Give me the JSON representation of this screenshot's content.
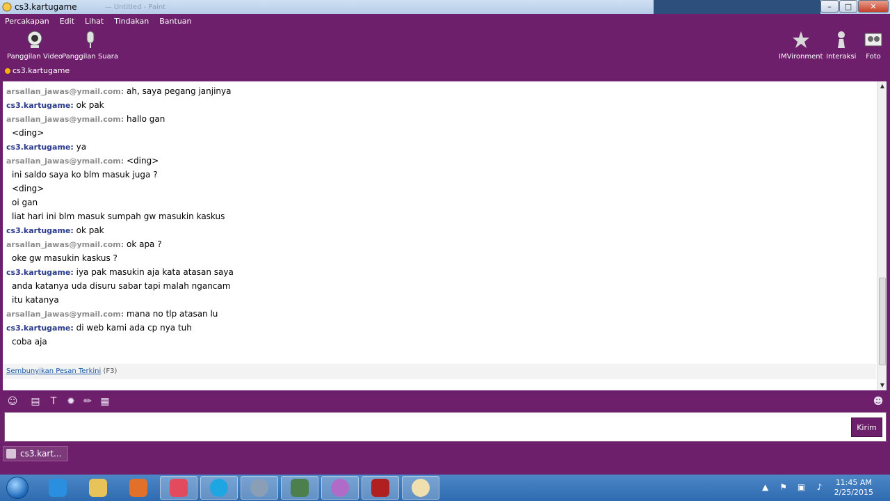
{
  "window": {
    "title": "cs3.kartugame",
    "ghost_title": "— Untitled - Paint"
  },
  "menu": [
    "Percakapan",
    "Edit",
    "Lihat",
    "Tindakan",
    "Bantuan"
  ],
  "toolbar": {
    "video_call": "Panggilan Video",
    "voice_call": "Panggilan Suara",
    "imvironment": "IMVironment",
    "interaksi": "Interaksi",
    "foto": "Foto"
  },
  "contact": {
    "name": "cs3.kartugame"
  },
  "chat": {
    "messages": [
      {
        "sender": "arsallan_jawas@ymail.com:",
        "kind": "a",
        "lines": [
          "ah, saya pegang janjinya"
        ]
      },
      {
        "sender": "cs3.kartugame:",
        "kind": "c",
        "lines": [
          "ok pak"
        ]
      },
      {
        "sender": "arsallan_jawas@ymail.com:",
        "kind": "a",
        "lines": [
          "hallo gan",
          "<ding>"
        ]
      },
      {
        "sender": "cs3.kartugame:",
        "kind": "c",
        "lines": [
          "ya"
        ]
      },
      {
        "sender": "arsallan_jawas@ymail.com:",
        "kind": "a",
        "lines": [
          "<ding>",
          "ini saldo saya ko blm masuk juga ?",
          "<ding>",
          "oi gan",
          "liat hari ini blm masuk sumpah gw masukin kaskus"
        ]
      },
      {
        "sender": "cs3.kartugame:",
        "kind": "c",
        "lines": [
          "ok pak"
        ]
      },
      {
        "sender": "arsallan_jawas@ymail.com:",
        "kind": "a",
        "lines": [
          "ok apa ?",
          "oke gw masukin kaskus ?"
        ]
      },
      {
        "sender": "cs3.kartugame:",
        "kind": "c",
        "lines": [
          "iya pak masukin aja kata atasan saya",
          "anda katanya uda disuru sabar tapi malah ngancam",
          "itu katanya"
        ]
      },
      {
        "sender": "arsallan_jawas@ymail.com:",
        "kind": "a",
        "lines": [
          "mana no tlp atasan lu"
        ]
      },
      {
        "sender": "cs3.kartugame:",
        "kind": "c",
        "lines": [
          "di web kami ada cp nya tuh",
          "coba aja"
        ]
      }
    ],
    "hide_link": "Sembunyikan Pesan Terkini",
    "hide_shortcut": "(F3)"
  },
  "input": {
    "send_label": "Kirim",
    "value": ""
  },
  "conv_tab": {
    "label": "cs3.kart..."
  },
  "taskbar": {
    "time": "11:45 AM",
    "date": "2/25/2015"
  },
  "colors": {
    "frame": "#6e1f6c",
    "contact": "#2a3a8c",
    "other": "#8c8c8c",
    "link": "#1b5aa5"
  }
}
